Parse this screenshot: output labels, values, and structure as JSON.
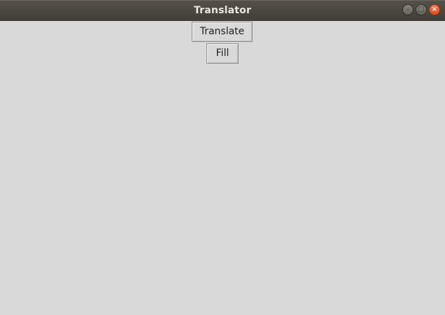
{
  "window": {
    "title": "Translator",
    "controls": {
      "minimize_icon": "minimize-icon",
      "maximize_icon": "maximize-icon",
      "close_icon": "close-icon"
    }
  },
  "buttons": {
    "translate_label": "Translate",
    "fill_label": "Fill"
  },
  "colors": {
    "titlebar": "#4a4640",
    "background": "#d9d9d9",
    "close_button": "#e95420"
  }
}
